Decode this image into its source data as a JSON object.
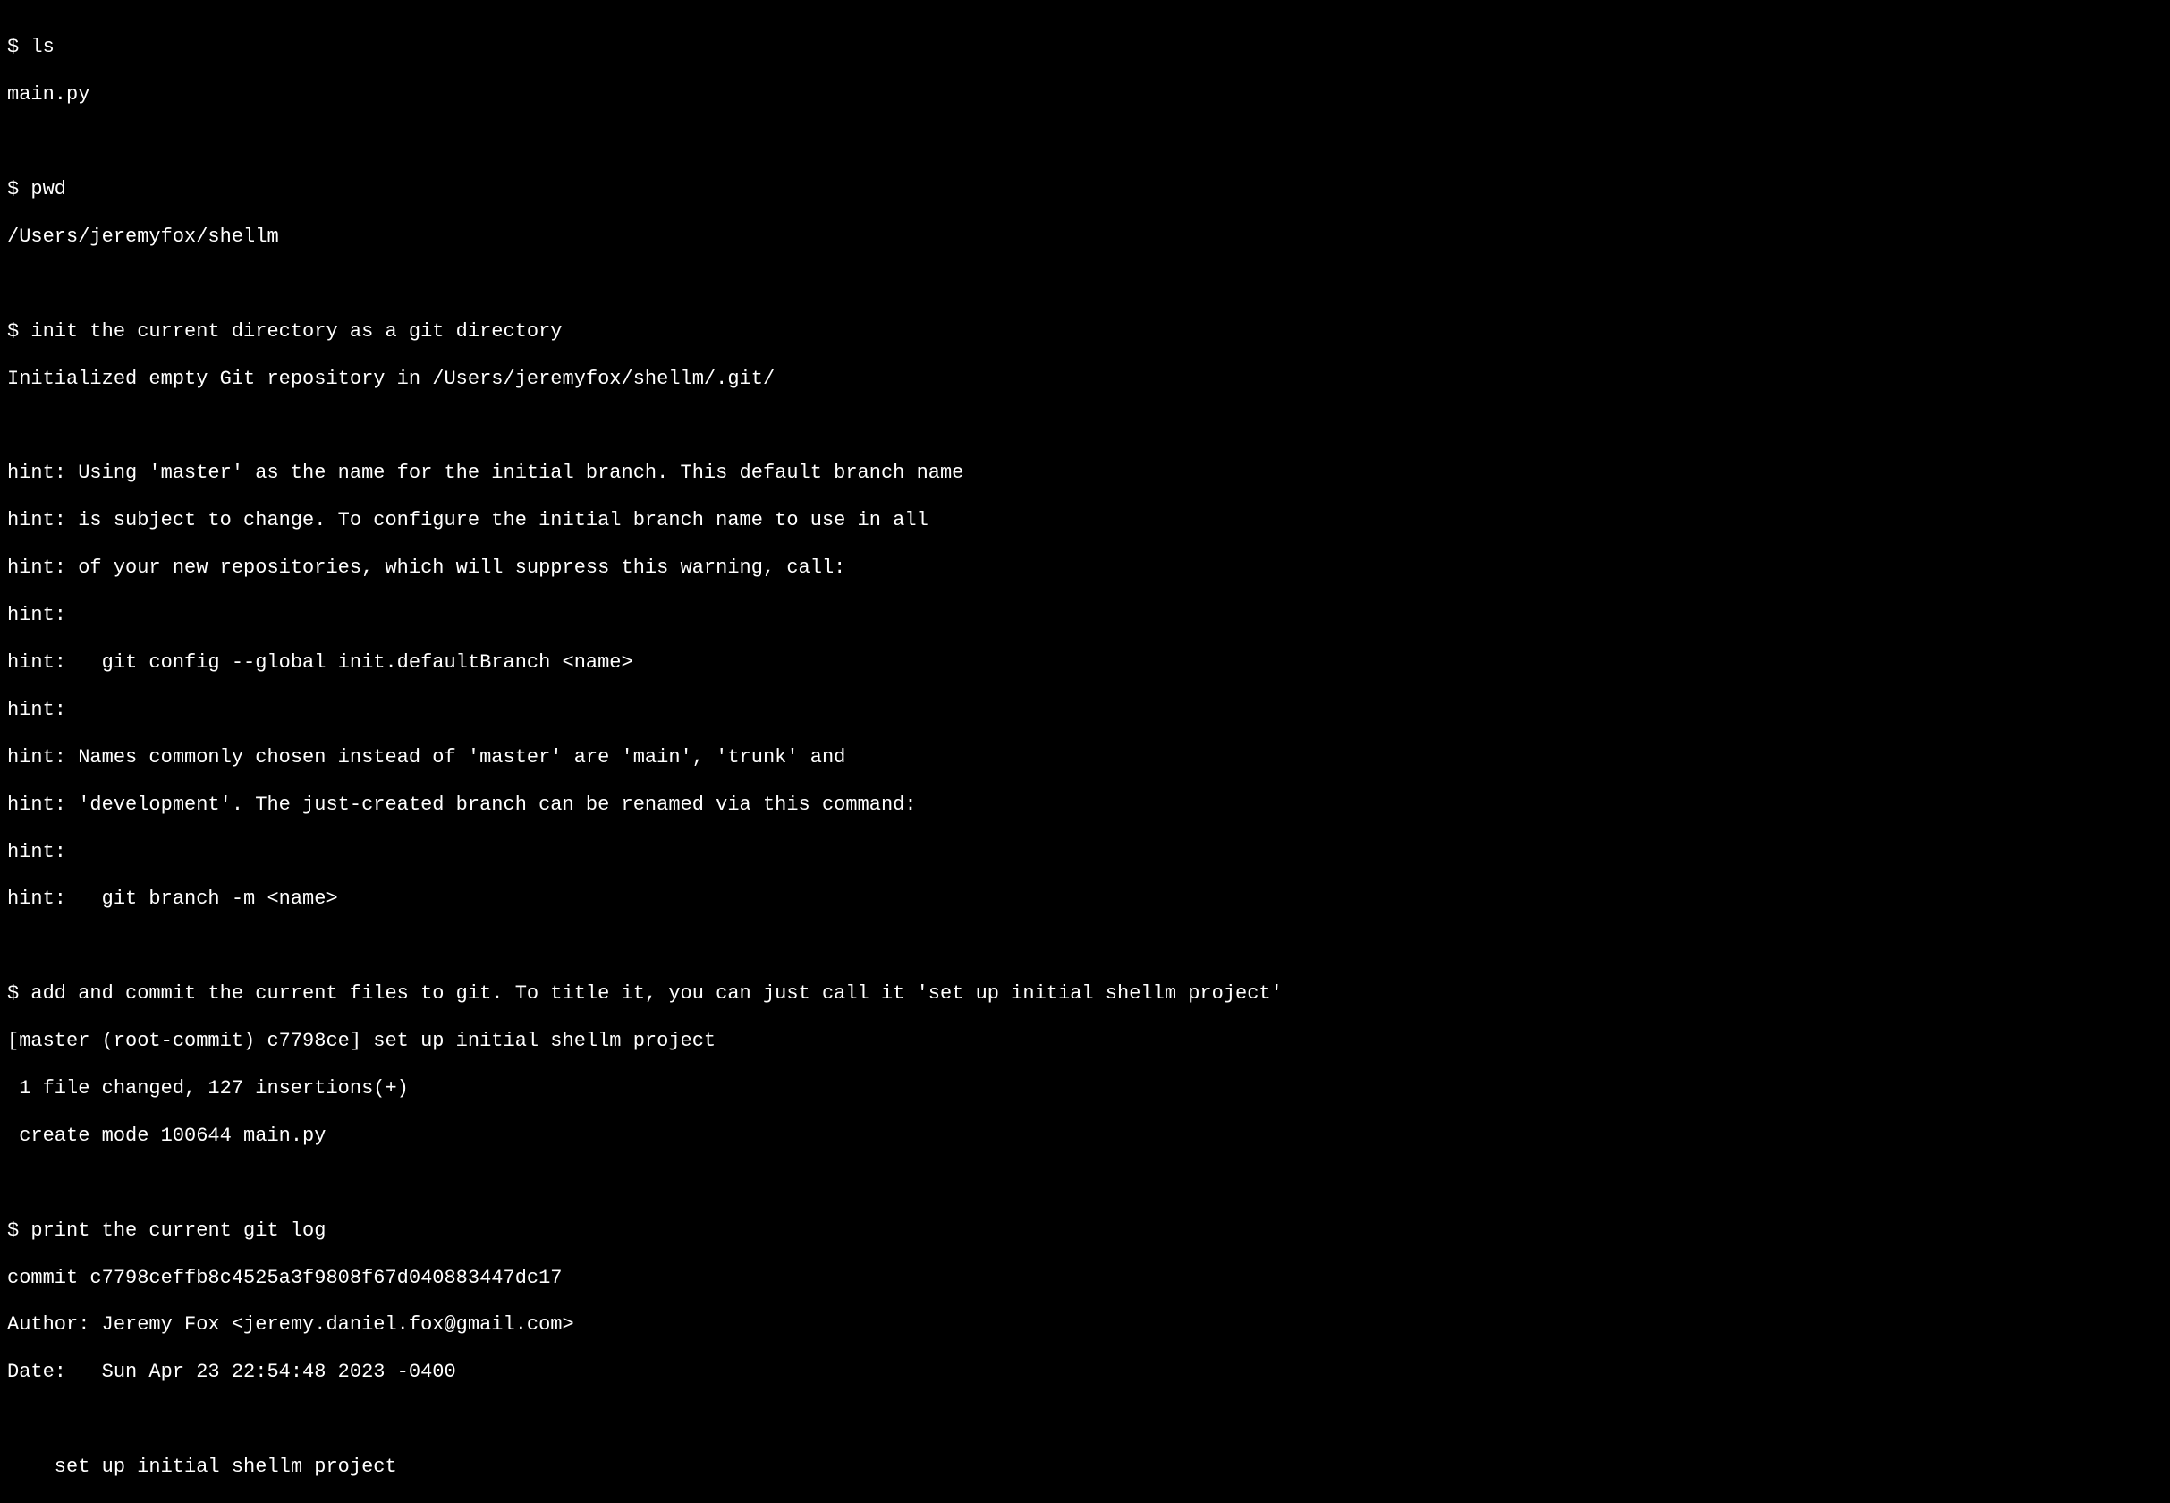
{
  "prompt": "$ ",
  "commands": {
    "ls": {
      "cmd": "ls",
      "output": [
        "main.py"
      ]
    },
    "pwd": {
      "cmd": "pwd",
      "output": [
        "/Users/jeremyfox/shellm"
      ]
    },
    "git_init": {
      "cmd": "init the current directory as a git directory",
      "output": [
        "Initialized empty Git repository in /Users/jeremyfox/shellm/.git/",
        "",
        "hint: Using 'master' as the name for the initial branch. This default branch name",
        "hint: is subject to change. To configure the initial branch name to use in all",
        "hint: of your new repositories, which will suppress this warning, call:",
        "hint:",
        "hint:   git config --global init.defaultBranch <name>",
        "hint:",
        "hint: Names commonly chosen instead of 'master' are 'main', 'trunk' and",
        "hint: 'development'. The just-created branch can be renamed via this command:",
        "hint:",
        "hint:   git branch -m <name>"
      ]
    },
    "git_commit": {
      "cmd": "add and commit the current files to git. To title it, you can just call it 'set up initial shellm project'",
      "output": [
        "[master (root-commit) c7798ce] set up initial shellm project",
        " 1 file changed, 127 insertions(+)",
        " create mode 100644 main.py"
      ]
    },
    "git_log": {
      "cmd": "print the current git log",
      "output": [
        "commit c7798ceffb8c4525a3f9808f67d040883447dc17",
        "Author: Jeremy Fox <jeremy.daniel.fox@gmail.com>",
        "Date:   Sun Apr 23 22:54:48 2023 -0400",
        "",
        "    set up initial shellm project"
      ]
    }
  }
}
